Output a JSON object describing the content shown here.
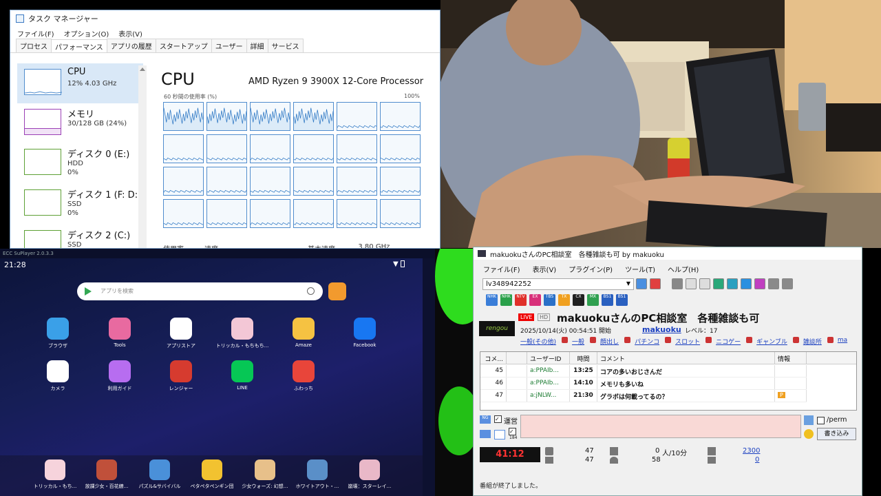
{
  "task_manager": {
    "title": "タスク マネージャー",
    "menu": [
      "ファイル(F)",
      "オプション(O)",
      "表示(V)"
    ],
    "tabs": [
      "プロセス",
      "パフォーマンス",
      "アプリの履歴",
      "スタートアップ",
      "ユーザー",
      "詳細",
      "サービス"
    ],
    "active_tab": 1,
    "side_items": [
      {
        "name": "CPU",
        "sub1": "12%  4.03 GHz",
        "sub2": "",
        "color": "#4f8ccd"
      },
      {
        "name": "メモリ",
        "sub1": "30/128 GB (24%)",
        "sub2": "",
        "color": "#9b3fb5"
      },
      {
        "name": "ディスク 0 (E:)",
        "sub1": "HDD",
        "sub2": "0%",
        "color": "#5da034"
      },
      {
        "name": "ディスク 1 (F: D:)",
        "sub1": "SSD",
        "sub2": "0%",
        "color": "#5da034"
      },
      {
        "name": "ディスク 2 (C:)",
        "sub1": "SSD",
        "sub2": "",
        "color": "#5da034"
      }
    ],
    "main_title": "CPU",
    "processor": "AMD Ryzen 9 3900X 12-Core Processor",
    "axis_left": "60 秒間の使用率 (%)",
    "axis_right": "100%",
    "bottom_labels": [
      "使用率",
      "速度",
      "基本速度:",
      "3.80 GHz"
    ]
  },
  "emulator": {
    "topbar_title": "ECC SuPlayer 2.0.3.3",
    "clock": "21:28",
    "search_placeholder": "アプリを検索",
    "apps_row1": [
      {
        "label": "ブラウザ",
        "color": "#3aa0e8"
      },
      {
        "label": "Tools",
        "color": "#e86aa0"
      },
      {
        "label": "アプリストア",
        "color": "#ffffff"
      },
      {
        "label": "トリッカル・もちもち...",
        "color": "#f3c7d6"
      },
      {
        "label": "Amaze",
        "color": "#f5c242"
      },
      {
        "label": "Facebook",
        "color": "#1877f2"
      }
    ],
    "apps_row2": [
      {
        "label": "カメラ",
        "color": "#ffffff"
      },
      {
        "label": "利用ガイド",
        "color": "#b76df0"
      },
      {
        "label": "レンジャー",
        "color": "#d63b2f"
      },
      {
        "label": "LINE",
        "color": "#06c755"
      },
      {
        "label": "ふわっち",
        "color": "#e8453a"
      }
    ],
    "dock": [
      {
        "label": "トリッカル・もち...",
        "color": "#f6d3dc"
      },
      {
        "label": "放課少女・百花繚...",
        "color": "#c0503a"
      },
      {
        "label": "パズル&サバイバル",
        "color": "#4a90d9"
      },
      {
        "label": "ペタペタペンギン団",
        "color": "#f2c230"
      },
      {
        "label": "少女ウォーズ: 幻想...",
        "color": "#e7c08a"
      },
      {
        "label": "ホワイトアウト・...",
        "color": "#5a8fc8"
      },
      {
        "label": "崩壊：スターレイ...",
        "color": "#e9b8c8"
      }
    ]
  },
  "comment_viewer": {
    "title": "makuokuさんのPC相談室　各種雑談も可 by makuoku",
    "menu": [
      "ファイル(F)",
      "表示(V)",
      "プラグイン(P)",
      "ツール(T)",
      "ヘルプ(H)"
    ],
    "live_id": "lv348942252",
    "channels": [
      {
        "label": "NHK",
        "color": "#3a7dd8"
      },
      {
        "label": "NHK",
        "color": "#2aa04a"
      },
      {
        "label": "NTV",
        "color": "#e0302a"
      },
      {
        "label": "EX",
        "color": "#d8307a"
      },
      {
        "label": "TBS",
        "color": "#2a70c8"
      },
      {
        "label": "TX",
        "color": "#f0a020"
      },
      {
        "label": "CX",
        "color": "#202020"
      },
      {
        "label": "MX",
        "color": "#30a050"
      },
      {
        "label": "BS1",
        "color": "#2a60c0"
      },
      {
        "label": "BS1",
        "color": "#2a60c0"
      }
    ],
    "logo": "rengou",
    "live_badge": "LIVE",
    "hd_badge": "HD",
    "program_title": "makuokuさんのPC相談室　各種雑談も可",
    "start": "2025/10/14(火) 00:54:51 開始",
    "owner": "makuoku",
    "level": "レベル：17",
    "categories": [
      "一般(その他)",
      "一般",
      "顔出し",
      "パチンコ",
      "スロット",
      "ニコゲー",
      "ギャンブル",
      "雑談所",
      "ma"
    ],
    "columns": [
      "コメ...",
      "",
      "ユーザーID",
      "時間",
      "コメント",
      "情報"
    ],
    "rows": [
      {
        "no": "45",
        "uid": "a:PPAIb...",
        "time": "13:25",
        "comment": "コアの多いおじさんだ",
        "info": ""
      },
      {
        "no": "46",
        "uid": "a:PPAIb...",
        "time": "14:10",
        "comment": "メモリも多いね",
        "info": ""
      },
      {
        "no": "47",
        "uid": "a:jNLW...",
        "time": "21:30",
        "comment": "グラボは何載ってるの？",
        "info": "P"
      }
    ],
    "labels": {
      "unei": "運営",
      "perm": "/perm",
      "write": "書き込み",
      "yoshi": "184"
    },
    "timer": "41:12",
    "stats": {
      "a1": "47",
      "a2": "47",
      "b1": "0",
      "b_unit": "人/10分",
      "b2": "58",
      "c1": "2300",
      "c2": "0"
    },
    "status": "番組が終了しました。"
  }
}
